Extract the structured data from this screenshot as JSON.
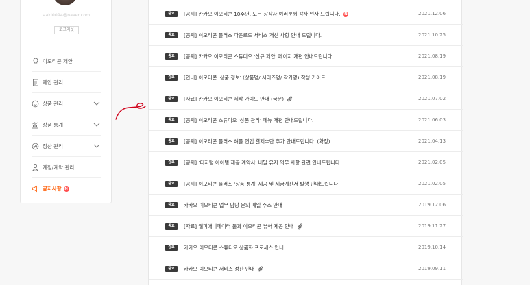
{
  "sidebar": {
    "email": "aaki0094@naver.com",
    "logout_label": "로그아웃",
    "items": [
      {
        "label": "이모티콘 제안",
        "icon": "lightbulb-icon",
        "chevron": false
      },
      {
        "label": "제안 관리",
        "icon": "document-icon",
        "chevron": false
      },
      {
        "label": "상품 관리",
        "icon": "smiley-icon",
        "chevron": true
      },
      {
        "label": "상품 통계",
        "icon": "chart-icon",
        "chevron": true
      },
      {
        "label": "정산 관리",
        "icon": "won-coin-icon",
        "chevron": true
      },
      {
        "label": "계정/계약 관리",
        "icon": "person-icon",
        "chevron": false
      },
      {
        "label": "공지사항",
        "icon": "megaphone-icon",
        "chevron": false,
        "active": true,
        "new_badge": "N"
      }
    ]
  },
  "notices": {
    "badge_label": "중요",
    "new_label": "N",
    "rows": [
      {
        "title": "[공지] 카카오 이모티콘 10주년, 모든 창작자 여러분께 감사 인사 드립니다.",
        "date": "2021.12.06",
        "new": true,
        "attachment": false
      },
      {
        "title": "[공지] 이모티콘 플러스 다운로드 서비스 개선 사항 안내 드립니다.",
        "date": "2021.10.25",
        "new": false,
        "attachment": false
      },
      {
        "title": "[공지] 카카오 이모티콘 스튜디오 '신규 제안' 페이지 개편 안내드립니다.",
        "date": "2021.08.19",
        "new": false,
        "attachment": false
      },
      {
        "title": "[안내] 이모티콘 '상품 정보' (상품명/ 시리즈명/ 작가명) 작성 가이드",
        "date": "2021.08.19",
        "new": false,
        "attachment": false
      },
      {
        "title": "[자료] 카카오 이모티콘 제작 가이드 안내 (국문)",
        "date": "2021.07.02",
        "new": false,
        "attachment": true
      },
      {
        "title": "[공지] 이모티콘 스튜디오 '상품 관리' 메뉴 개편 안내드립니다.",
        "date": "2021.06.03",
        "new": false,
        "attachment": false
      },
      {
        "title": "[공지] 이모티콘 플러스 해플 인앱 결제수단 추가 안내드립니다. (확정)",
        "date": "2021.04.13",
        "new": false,
        "attachment": false
      },
      {
        "title": "[공지] '디지털 아이템 제공 계약서' 비밀 유지 의무 사항 관련 안내드립니다.",
        "date": "2021.02.05",
        "new": false,
        "attachment": false
      },
      {
        "title": "[공지] 이모티콘 플러스 '상품 통계' 제공 및 세금계산서 발행 안내드립니다.",
        "date": "2021.02.05",
        "new": false,
        "attachment": false
      },
      {
        "title": "카카오 이모티콘 업무 담당 문의 메일 주소 안내",
        "date": "2019.12.06",
        "new": false,
        "attachment": false
      },
      {
        "title": "[자료] 웹피애니메이터 툴과 이모티콘 뷰어 제공 안내",
        "date": "2019.11.27",
        "new": false,
        "attachment": true
      },
      {
        "title": "카카오 이모티콘 스튜디오 상품화 프로세스 안내",
        "date": "2019.10.14",
        "new": false,
        "attachment": false
      },
      {
        "title": "카카오 이모티콘 서비스 정산 안내",
        "date": "2019.09.11",
        "new": false,
        "attachment": true
      }
    ]
  },
  "colors": {
    "accent": "#ff5a00",
    "new_badge": "#ff4d4d",
    "badge_bg": "#3a3a3a",
    "scribble": "#d0021b"
  }
}
